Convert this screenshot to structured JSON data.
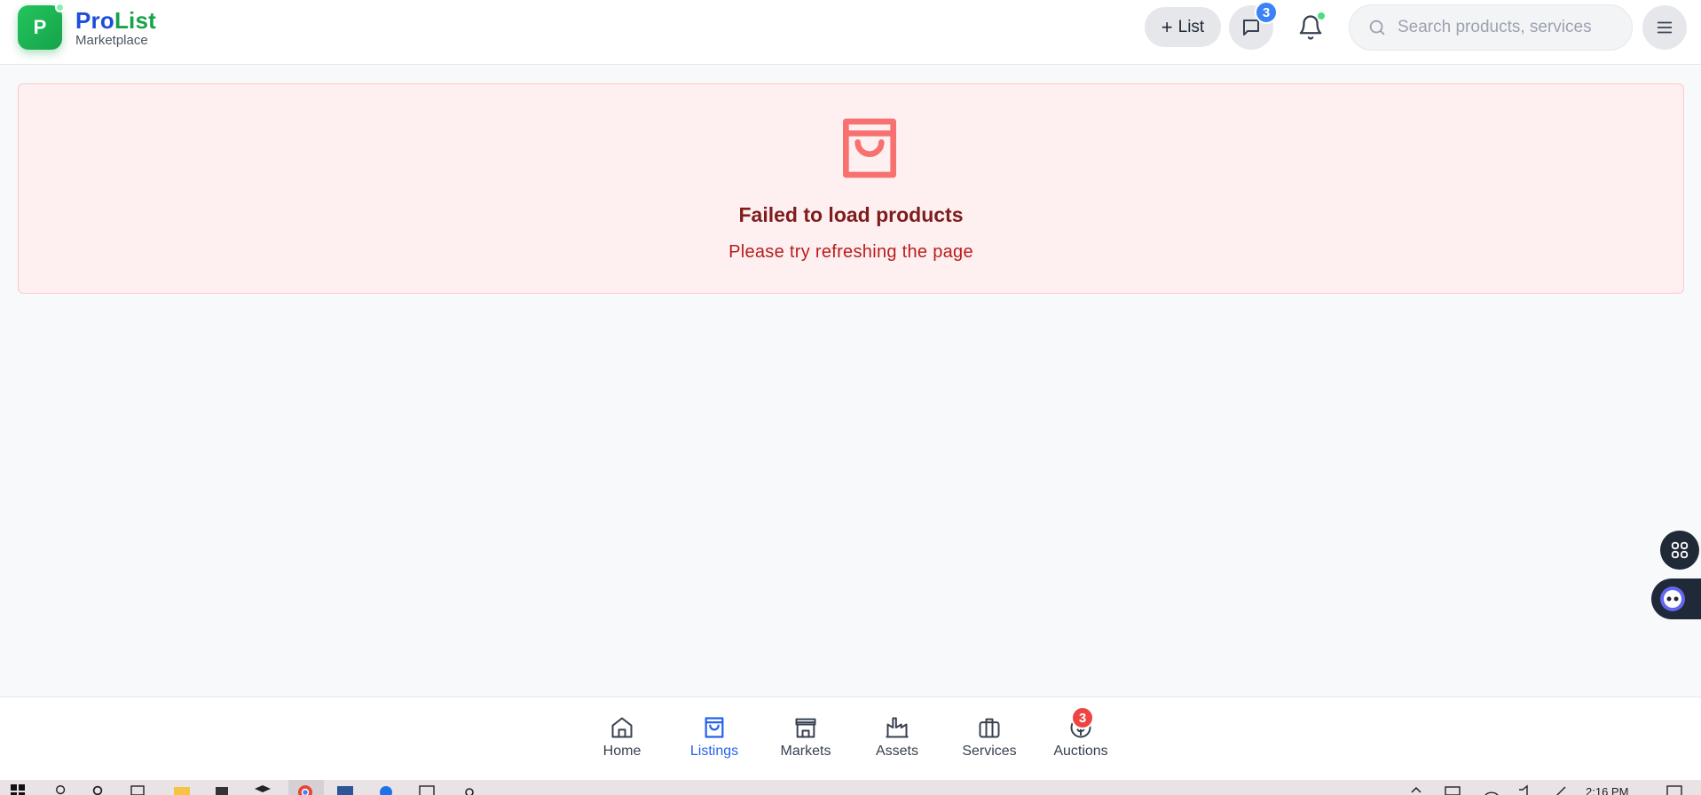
{
  "header": {
    "logo_letter": "P",
    "brand_pro": "Pro",
    "brand_list": "List",
    "brand_sub": "Marketplace",
    "list_button": {
      "plus": "+",
      "label": "List"
    },
    "chat_badge": "3",
    "search_placeholder": "Search products, services"
  },
  "error": {
    "icon": "shopping-bag-icon",
    "title": "Failed to load products",
    "subtitle": "Please try refreshing the page",
    "color": "#f87171"
  },
  "bottom_nav": {
    "items": [
      {
        "label": "Home",
        "icon": "home-icon",
        "active": false
      },
      {
        "label": "Listings",
        "icon": "shopping-bag-icon",
        "active": true
      },
      {
        "label": "Markets",
        "icon": "store-icon",
        "active": false
      },
      {
        "label": "Assets",
        "icon": "factory-icon",
        "active": false
      },
      {
        "label": "Services",
        "icon": "briefcase-icon",
        "active": false
      },
      {
        "label": "Auctions",
        "icon": "dollar-coin-icon",
        "active": false
      }
    ],
    "auction_badge": "3",
    "active_color": "#2563eb"
  },
  "taskbar": {
    "time": "2:16 PM"
  }
}
